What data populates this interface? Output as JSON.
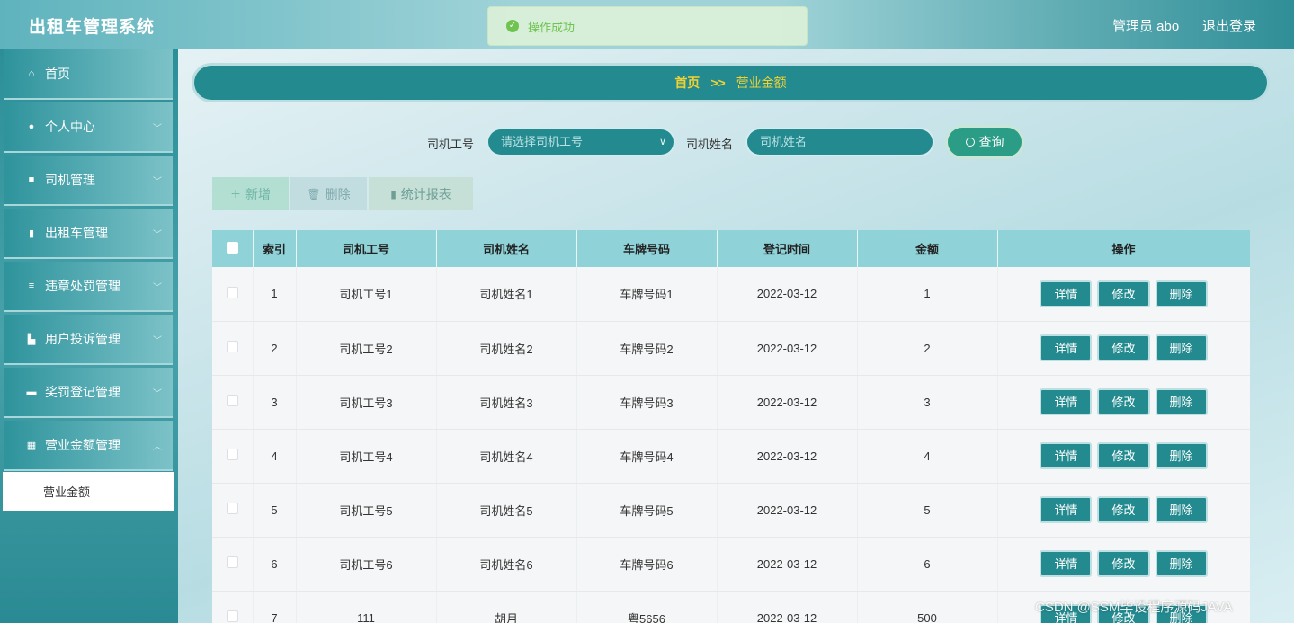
{
  "header": {
    "title": "出租车管理系统",
    "user": "管理员 abo",
    "logout": "退出登录"
  },
  "toast": {
    "text": "操作成功"
  },
  "sidebar": {
    "items": [
      {
        "label": "首页",
        "icon": "home-icon",
        "has_children": false
      },
      {
        "label": "个人中心",
        "icon": "user-icon",
        "has_children": true
      },
      {
        "label": "司机管理",
        "icon": "briefcase-icon",
        "has_children": true
      },
      {
        "label": "出租车管理",
        "icon": "book-icon",
        "has_children": true
      },
      {
        "label": "违章处罚管理",
        "icon": "sliders-icon",
        "has_children": true
      },
      {
        "label": "用户投诉管理",
        "icon": "shop-icon",
        "has_children": true
      },
      {
        "label": "奖罚登记管理",
        "icon": "ticket-icon",
        "has_children": true
      },
      {
        "label": "营业金额管理",
        "icon": "grid-icon",
        "has_children": true
      }
    ],
    "active_sub": "营业金额"
  },
  "breadcrumb": {
    "home": "首页",
    "sep": ">>",
    "current": "营业金额"
  },
  "search": {
    "driver_id_label": "司机工号",
    "driver_id_placeholder": "请选择司机工号",
    "driver_name_label": "司机姓名",
    "driver_name_placeholder": "司机姓名",
    "query_button": "查询"
  },
  "actions": {
    "add": "新增",
    "delete": "删除",
    "stats": "统计报表"
  },
  "table": {
    "columns": [
      "索引",
      "司机工号",
      "司机姓名",
      "车牌号码",
      "登记时间",
      "金额",
      "操作"
    ],
    "row_buttons": {
      "detail": "详情",
      "edit": "修改",
      "delete": "删除"
    },
    "rows": [
      {
        "index": "1",
        "driver_id": "司机工号1",
        "driver_name": "司机姓名1",
        "plate": "车牌号码1",
        "date": "2022-03-12",
        "amount": "1"
      },
      {
        "index": "2",
        "driver_id": "司机工号2",
        "driver_name": "司机姓名2",
        "plate": "车牌号码2",
        "date": "2022-03-12",
        "amount": "2"
      },
      {
        "index": "3",
        "driver_id": "司机工号3",
        "driver_name": "司机姓名3",
        "plate": "车牌号码3",
        "date": "2022-03-12",
        "amount": "3"
      },
      {
        "index": "4",
        "driver_id": "司机工号4",
        "driver_name": "司机姓名4",
        "plate": "车牌号码4",
        "date": "2022-03-12",
        "amount": "4"
      },
      {
        "index": "5",
        "driver_id": "司机工号5",
        "driver_name": "司机姓名5",
        "plate": "车牌号码5",
        "date": "2022-03-12",
        "amount": "5"
      },
      {
        "index": "6",
        "driver_id": "司机工号6",
        "driver_name": "司机姓名6",
        "plate": "车牌号码6",
        "date": "2022-03-12",
        "amount": "6"
      },
      {
        "index": "7",
        "driver_id": "111",
        "driver_name": "胡月",
        "plate": "粤5656",
        "date": "2022-03-12",
        "amount": "500"
      }
    ]
  },
  "watermark": "CSDN @SSM毕设程序源码JAVA"
}
